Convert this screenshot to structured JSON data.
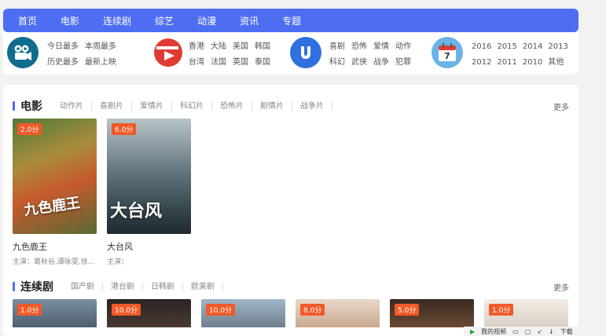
{
  "nav": [
    "首页",
    "电影",
    "连续剧",
    "综艺",
    "动漫",
    "资讯",
    "专题"
  ],
  "categories": {
    "group1": {
      "row1": [
        "今日最多",
        "本周最多"
      ],
      "row2": [
        "历史最多",
        "最新上映"
      ]
    },
    "group2": {
      "row1": [
        "香港",
        "大陆",
        "美国",
        "韩国"
      ],
      "row2": [
        "台湾",
        "法国",
        "英国",
        "泰国"
      ]
    },
    "group3": {
      "row1": [
        "喜剧",
        "恐怖",
        "爱情",
        "动作"
      ],
      "row2": [
        "科幻",
        "武侠",
        "战争",
        "犯罪"
      ]
    },
    "group4": {
      "row1": [
        "2016",
        "2015",
        "2014",
        "2013"
      ],
      "row2": [
        "2012",
        "2011",
        "2010",
        "其他"
      ],
      "calendar_day": "7"
    }
  },
  "movies": {
    "title": "电影",
    "tabs": [
      "动作片",
      "喜剧片",
      "爱情片",
      "科幻片",
      "恐怖片",
      "剧情片",
      "战争片"
    ],
    "more": "更多",
    "items": [
      {
        "score": "2.0分",
        "name": "九色鹿王",
        "cast": "主演：葛秋谷,谭咏雯,徐...",
        "poster_text": "九色鹿王"
      },
      {
        "score": "6.0分",
        "name": "大台风",
        "cast": "主演：",
        "poster_text": "大台风"
      }
    ]
  },
  "series": {
    "title": "连续剧",
    "tabs": [
      "国产剧",
      "港台剧",
      "日韩剧",
      "欧美剧"
    ],
    "more": "更多",
    "scores": [
      "1.0分",
      "10.0分",
      "10.0分",
      "8.0分",
      "5.0分",
      "1.0分"
    ]
  },
  "statusbar": {
    "item1": "我的视频",
    "item2": "下载"
  },
  "colors": {
    "accent": "#4e6ef2",
    "badge": "#f05a28"
  }
}
